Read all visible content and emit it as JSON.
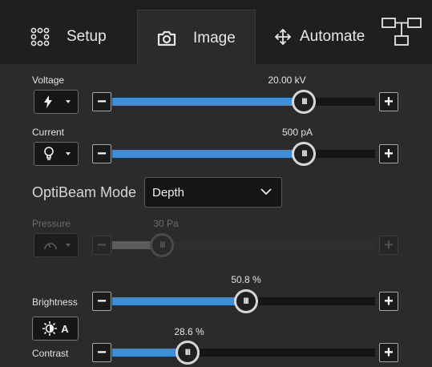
{
  "tabs": [
    {
      "label": "Setup",
      "icon": "setup-grid-icon"
    },
    {
      "label": "Image",
      "icon": "camera-icon",
      "active": true
    },
    {
      "label": "Automate",
      "icon": "move-arrows-icon"
    }
  ],
  "layout_icon": "layout-tree-icon",
  "voltage": {
    "label": "Voltage",
    "value_text": "20.00 kV",
    "level": 0.73,
    "icon": "lightning-icon"
  },
  "current": {
    "label": "Current",
    "value_text": "500 pA",
    "level": 0.73,
    "icon": "bulb-icon"
  },
  "optibeam": {
    "label": "OptiBeam Mode",
    "selected": "Depth"
  },
  "pressure": {
    "label": "Pressure",
    "value_text": "30 Pa",
    "level": 0.19,
    "enabled": false,
    "icon": "gauge-icon"
  },
  "brightness": {
    "label": "Brightness",
    "value_text": "50.8 %",
    "level": 0.508
  },
  "auto_button": {
    "label": "A",
    "icon": "auto-brightness-icon"
  },
  "contrast": {
    "label": "Contrast",
    "value_text": "28.6 %",
    "level": 0.286
  },
  "buttons": {
    "minus": "−",
    "plus": "+",
    "thumb": "III"
  },
  "colors": {
    "accent": "#3d8fd9",
    "background": "#2b2b2b",
    "tabbar": "#1f1f1f"
  }
}
